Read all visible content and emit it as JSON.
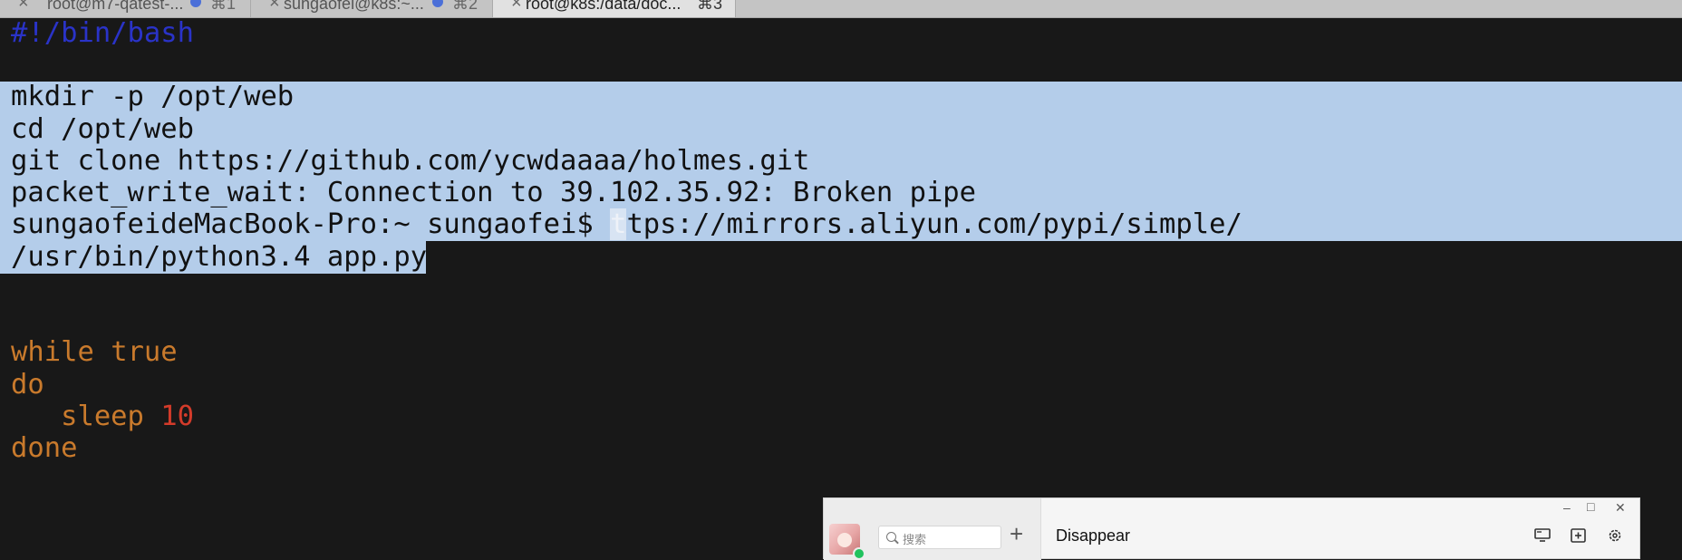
{
  "tabs": [
    {
      "title": "root@m7-qatest-...",
      "shortcut": "⌘1"
    },
    {
      "title": "sungaofei@k8s:~...",
      "shortcut": "⌘2"
    },
    {
      "title": "root@k8s:/data/doc...",
      "shortcut": "⌘3"
    }
  ],
  "terminal": {
    "shebang": "#!/bin/bash",
    "selected_lines": [
      "mkdir -p /opt/web",
      "cd /opt/web",
      "git clone https://github.com/ycwdaaaa/holmes.git",
      "packet_write_wait: Connection to 39.102.35.92: Broken pipe"
    ],
    "prompt_line": {
      "prompt": "sungaofeideMacBook-Pro:~ sungaofei$ ",
      "cursor_char": "t",
      "rest": "tps://mirrors.aliyun.com/pypi/simple/"
    },
    "python_line": "/usr/bin/python3.4 app.py",
    "loop": {
      "while": "while",
      "true": "true",
      "do": "do",
      "sleep": "sleep",
      "sleep_value": "10",
      "done": "done"
    }
  },
  "chat_window": {
    "search_placeholder": "搜索",
    "plus_label": "+",
    "conversation_title": "Disappear",
    "minimize": "–",
    "maximize": "□",
    "close": "✕"
  }
}
